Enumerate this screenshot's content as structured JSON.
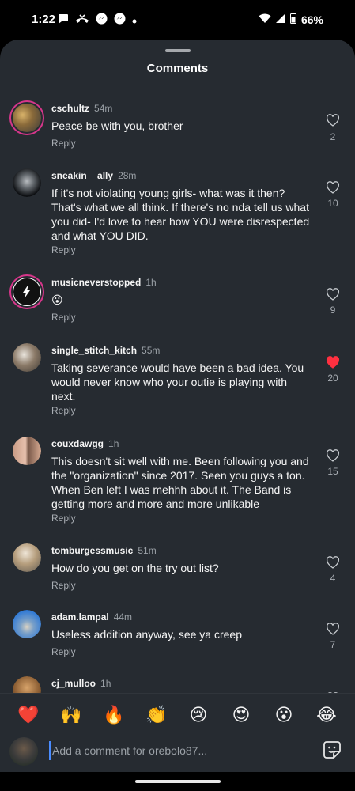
{
  "status_bar": {
    "time": "1:22",
    "battery": "66%",
    "notif_icons": [
      "message-icon",
      "missed-call-icon",
      "messenger-icon",
      "messenger-icon",
      "dot-icon"
    ]
  },
  "sheet": {
    "title": "Comments"
  },
  "comments": [
    {
      "username": "cschultz",
      "time": "54m",
      "text": "Peace be with you, brother",
      "reply": "Reply",
      "likes": "2",
      "liked": false
    },
    {
      "username": "sneakin__ally",
      "time": "28m",
      "text": "If it's not violating young girls- what was it then? That's what we all think. If there's no nda tell us what you did- I'd love to hear how YOU were disrespected and what YOU DID.",
      "reply": "Reply",
      "likes": "10",
      "liked": false
    },
    {
      "username": "musicneverstopped",
      "time": "1h",
      "text": "😮",
      "reply": "Reply",
      "likes": "9",
      "liked": false
    },
    {
      "username": "single_stitch_kitch",
      "time": "55m",
      "text": "Taking severance would have been a bad idea. You would never know who your outie is playing with next.",
      "reply": "Reply",
      "likes": "20",
      "liked": true
    },
    {
      "username": "couxdawgg",
      "time": "1h",
      "text": "This doesn't sit well with me.  Been following you and the \"organization\" since 2017.  Seen you guys a ton.  When Ben left I was mehhh about it.  The Band is getting more and more and more unlikable",
      "reply": "Reply",
      "likes": "15",
      "liked": false
    },
    {
      "username": "tomburgessmusic",
      "time": "51m",
      "text": "How do you get on the try out list?",
      "reply": "Reply",
      "likes": "4",
      "liked": false
    },
    {
      "username": "adam.lampal",
      "time": "44m",
      "text": "Useless addition anyway, see ya creep",
      "reply": "Reply",
      "likes": "7",
      "liked": false
    },
    {
      "username": "cj_mulloo",
      "time": "1h",
      "text": "",
      "reply": "",
      "likes": "",
      "liked": false
    }
  ],
  "emoji_bar": [
    "❤️",
    "🙌",
    "🔥",
    "👏",
    "😢",
    "😍",
    "😮",
    "😂"
  ],
  "composer": {
    "placeholder": "Add a comment for orebolo87..."
  },
  "colors": {
    "accent_like": "#ff3040",
    "sheet_bg": "#262b31",
    "muted_text": "#a8adb3"
  }
}
